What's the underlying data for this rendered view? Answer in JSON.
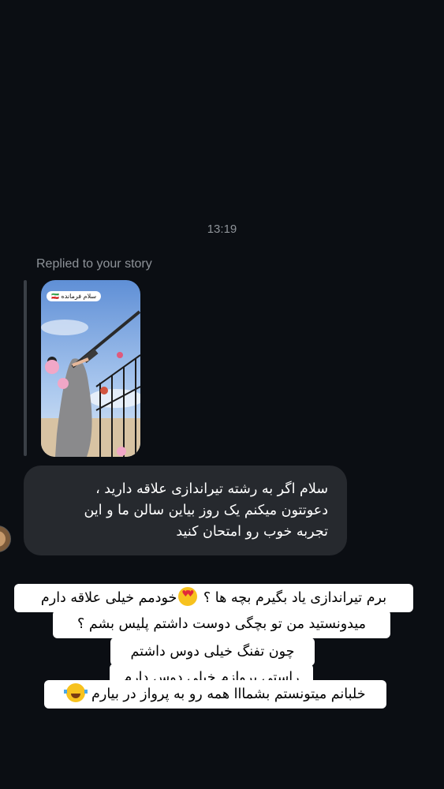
{
  "timestamp": "13:19",
  "reply_header": "Replied to your story",
  "story": {
    "label": "سلام فرمانده 🇮🇷"
  },
  "message": {
    "lines": [
      "سلام اگر به رشته تیراندازی علاقه دارید ،",
      "دعوتتون میکنم یک روز بیاین سالن ما و این",
      "تجربه خوب رو امتحان کنید"
    ]
  },
  "caption": {
    "line1": "برم تیراندازی یاد بگیرم بچه ها ؟ 😍خودمم خیلی علاقه دارم",
    "line1_a": "برم تیراندازی یاد بگیرم بچه ها ؟",
    "line1_b": "خودمم خیلی علاقه دارم",
    "line2": "میدونستید من تو بچگی دوست داشتم پلیس بشم ؟",
    "line3": "چون تفنگ خیلی دوس داشتم",
    "line4": "راستی پروازم خیلی دوس دارم",
    "line5": "خلبانم میتونستم بشمااا همه رو به پرواز در بیارم",
    "emoji_hearts": "smiling-face-with-heart-eyes",
    "emoji_joy": "face-with-tears-of-joy"
  },
  "colors": {
    "background": "#0b0e13",
    "bubble": "#26292e",
    "caption_bg": "#ffffff",
    "muted_text": "#8e9399"
  }
}
